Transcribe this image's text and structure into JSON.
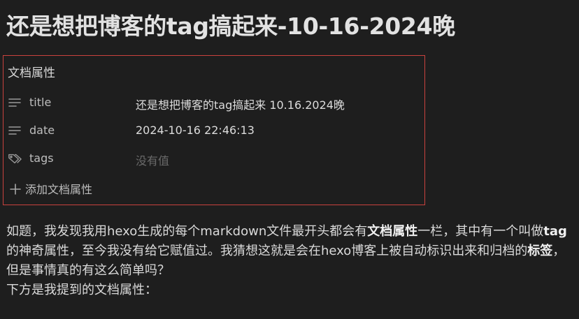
{
  "note": {
    "title": "还是想把博客的tag搞起来-10-16-2024晚"
  },
  "properties": {
    "heading": "文档属性",
    "items": [
      {
        "key": "title",
        "value": "还是想把博客的tag搞起来 10.16.2024晚",
        "icon": "text-lines-icon",
        "empty": false
      },
      {
        "key": "date",
        "value": "2024-10-16 22:46:13",
        "icon": "text-lines-icon",
        "empty": false
      },
      {
        "key": "tags",
        "value": "没有值",
        "icon": "tags-icon",
        "empty": true
      }
    ],
    "add_label": "添加文档属性",
    "border_color": "#c9423e"
  },
  "body": {
    "p1_a": "如题，我发现我用hexo生成的每个markdown文件最开头都会有",
    "p1_b": "文档属性",
    "p1_c": "一栏，其中有一个叫做",
    "p1_d": "tag",
    "p1_e": "的神奇属性，至今我没有给它赋值过。我猜想这就是会在hexo博客上被自动标识出来和归档的",
    "p1_f": "标签",
    "p1_g": "，但是事情真的有这么简单吗？",
    "p2": "下方是我提到的文档属性："
  }
}
